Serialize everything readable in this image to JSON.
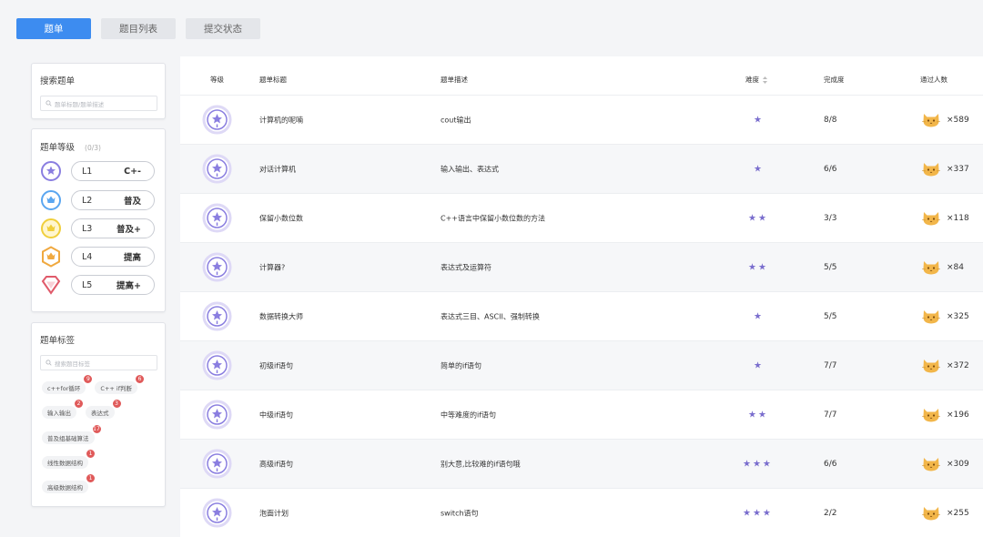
{
  "tabs": [
    "题单",
    "题目列表",
    "提交状态"
  ],
  "search": {
    "title": "搜索题单",
    "placeholder": "题单标题/题单描述"
  },
  "levels": {
    "title": "题单等级",
    "count": "(0/3)",
    "items": [
      {
        "code": "L1",
        "name": "C+-",
        "color": "#8a7ee0"
      },
      {
        "code": "L2",
        "name": "普及",
        "color": "#5aa6f0"
      },
      {
        "code": "L3",
        "name": "普及+",
        "color": "#f0cf3c"
      },
      {
        "code": "L4",
        "name": "提高",
        "color": "#f0a940"
      },
      {
        "code": "L5",
        "name": "提高+",
        "color": "#e05a6a"
      }
    ]
  },
  "tags": {
    "title": "题单标签",
    "placeholder": "搜索题目标签",
    "items": [
      {
        "label": "c++for循环",
        "count": "9"
      },
      {
        "label": "C++ if判断",
        "count": "6"
      },
      {
        "label": "输入输出",
        "count": "2"
      },
      {
        "label": "表达式",
        "count": "3"
      },
      {
        "label": "普及组基础算法",
        "count": "17"
      },
      {
        "label": "线性数据结构",
        "count": "1"
      },
      {
        "label": "高级数据结构",
        "count": "1"
      }
    ]
  },
  "table": {
    "headers": [
      "等级",
      "题单标题",
      "题单描述",
      "难度",
      "完成度",
      "通过人数"
    ],
    "rows": [
      {
        "title": "计算机的呢喃",
        "desc": "cout输出",
        "stars": 1,
        "progress": "8/8",
        "passed": "×589"
      },
      {
        "title": "对话计算机",
        "desc": "输入输出、表达式",
        "stars": 1,
        "progress": "6/6",
        "passed": "×337"
      },
      {
        "title": "保留小数位数",
        "desc": "C++语言中保留小数位数的方法",
        "stars": 2,
        "progress": "3/3",
        "passed": "×118"
      },
      {
        "title": "计算器?",
        "desc": "表达式及运算符",
        "stars": 2,
        "progress": "5/5",
        "passed": "×84"
      },
      {
        "title": "数据转换大师",
        "desc": "表达式三目、ASCII、强制转换",
        "stars": 1,
        "progress": "5/5",
        "passed": "×325"
      },
      {
        "title": "初级if语句",
        "desc": "简单的if语句",
        "stars": 1,
        "progress": "7/7",
        "passed": "×372"
      },
      {
        "title": "中级if语句",
        "desc": "中等难度的if语句",
        "stars": 2,
        "progress": "7/7",
        "passed": "×196"
      },
      {
        "title": "高级if语句",
        "desc": "别大意,比较难的if语句哦",
        "stars": 3,
        "progress": "6/6",
        "passed": "×309"
      },
      {
        "title": "泡面计划",
        "desc": "switch语句",
        "stars": 3,
        "progress": "2/2",
        "passed": "×255"
      }
    ]
  },
  "colors": {
    "accent": "#3d8cf0",
    "star": "#7b6fce",
    "badge": "#e05a5a",
    "level1": "#8a7ee0",
    "cat": "#f2b64a"
  }
}
